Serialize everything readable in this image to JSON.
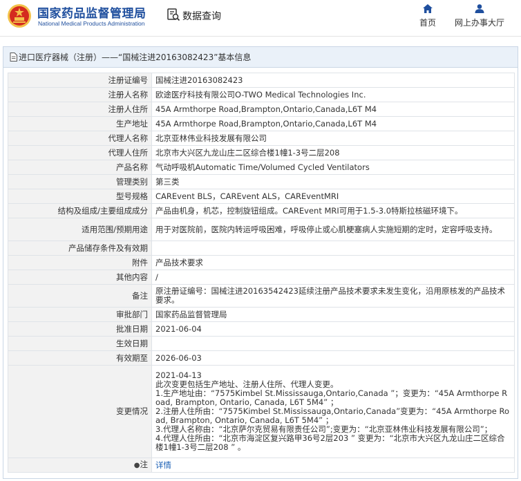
{
  "header": {
    "logo_cn": "国家药品监督管理局",
    "logo_en": "National Medical Products Administration",
    "query_label": "数据查询",
    "nav_home": "首页",
    "nav_hall": "网上办事大厅"
  },
  "colors": {
    "brand_blue": "#1f4f9e",
    "emblem_red": "#d42b1f",
    "emblem_gold": "#f3c24a",
    "link_blue": "#1a5fb4"
  },
  "panel": {
    "title": "进口医疗器械（注册）——“国械注进20163082423”基本信息"
  },
  "rows": [
    {
      "key": "注册证编号",
      "value": "国械注进20163082423"
    },
    {
      "key": "注册人名称",
      "value": "欧途医疗科技有限公司O-TWO Medical Technologies Inc."
    },
    {
      "key": "注册人住所",
      "value": "45A Armthorpe Road,Brampton,Ontario,Canada,L6T M4"
    },
    {
      "key": "生产地址",
      "value": "45A Armthorpe Road,Brampton,Ontario,Canada,L6T M4"
    },
    {
      "key": "代理人名称",
      "value": "北京亚林伟业科技发展有限公司"
    },
    {
      "key": "代理人住所",
      "value": "北京市大兴区九龙山庄二区综合楼1幢1-3号二层208"
    },
    {
      "key": "产品名称",
      "value": "气动呼吸机Automatic Time/Volumed Cycled Ventilators"
    },
    {
      "key": "管理类别",
      "value": "第三类"
    },
    {
      "key": "型号规格",
      "value": "CAREvent BLS，CAREvent ALS，CAREventMRI"
    },
    {
      "key": "结构及组成/主要组成成分",
      "value": "产品由机身，机芯，控制旋钮组成。CAREvent MRI可用于1.5-3.0特斯拉核磁环境下。"
    },
    {
      "key": "适用范围/预期用途",
      "value": "用于对医院前，医院内转运呼吸困难，呼吸停止或心肌梗塞病人实施短期的定时，定容呼吸支持。"
    },
    {
      "key": "产品储存条件及有效期",
      "value": ""
    },
    {
      "key": "附件",
      "value": "产品技术要求"
    },
    {
      "key": "其他内容",
      "value": "/"
    },
    {
      "key": "备注",
      "value": "原注册证编号：国械注进20163542423延续注册产品技术要求未发生变化，沿用原核发的产品技术要求。"
    },
    {
      "key": "审批部门",
      "value": "国家药品监督管理局"
    },
    {
      "key": "批准日期",
      "value": "2021-06-04"
    },
    {
      "key": "生效日期",
      "value": ""
    },
    {
      "key": "有效期至",
      "value": "2026-06-03"
    }
  ],
  "change": {
    "key": "变更情况",
    "lines": [
      "2021-04-13",
      "此次变更包括生产地址、注册人住所、代理人变更。",
      "1.生产地址由：“7575Kimbel St.Mississauga,Ontario,Canada ”；变更为：“45A Armthorpe Road, Brampton, Ontario, Canada, L6T 5M4” ；",
      "2.注册人住所由：“7575Kimbel St.Mississauga,Ontario,Canada”变更为：“45A Armthorpe Road, Brampton, Ontario, Canada, L6T 5M4” ；",
      "3.代理人名称由：“北京萨尔克贸易有限责任公司”;变更为：“北京亚林伟业科技发展有限公司”；",
      "4.代理人住所由：“北京市海淀区复兴路甲36号2层203 ” 变更为：“北京市大兴区九龙山庄二区综合楼1幢1-3号二层208 ” 。"
    ]
  },
  "note": {
    "key": "注",
    "link": "详情"
  }
}
